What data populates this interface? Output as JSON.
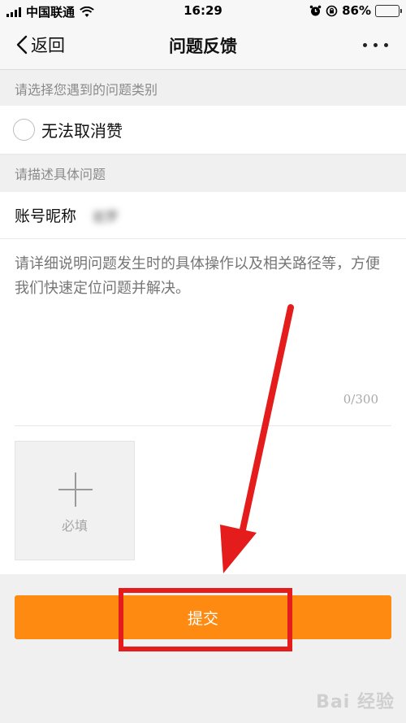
{
  "status_bar": {
    "carrier": "中国联通",
    "time": "16:29",
    "battery_percent": "86%",
    "battery_level": 0.86,
    "icons": [
      "signal-icon",
      "wifi-icon",
      "alarm-icon",
      "orientation-lock-icon",
      "battery-icon"
    ]
  },
  "nav": {
    "back_label": "返回",
    "title": "问题反馈"
  },
  "category": {
    "section_label": "请选择您遇到的问题类别",
    "option_label": "无法取消赞"
  },
  "describe": {
    "section_label": "请描述具体问题",
    "account_label": "账号昵称",
    "account_value": "岩罗",
    "placeholder": "请详细说明问题发生时的具体操作以及相关路径等，方便我们快速定位问题并解决。",
    "counter": "0/300",
    "upload_label": "必填"
  },
  "submit_label": "提交",
  "watermark": "Bai 经验",
  "colors": {
    "accent": "#ff8a12",
    "annotation_red": "#e41c1c"
  }
}
